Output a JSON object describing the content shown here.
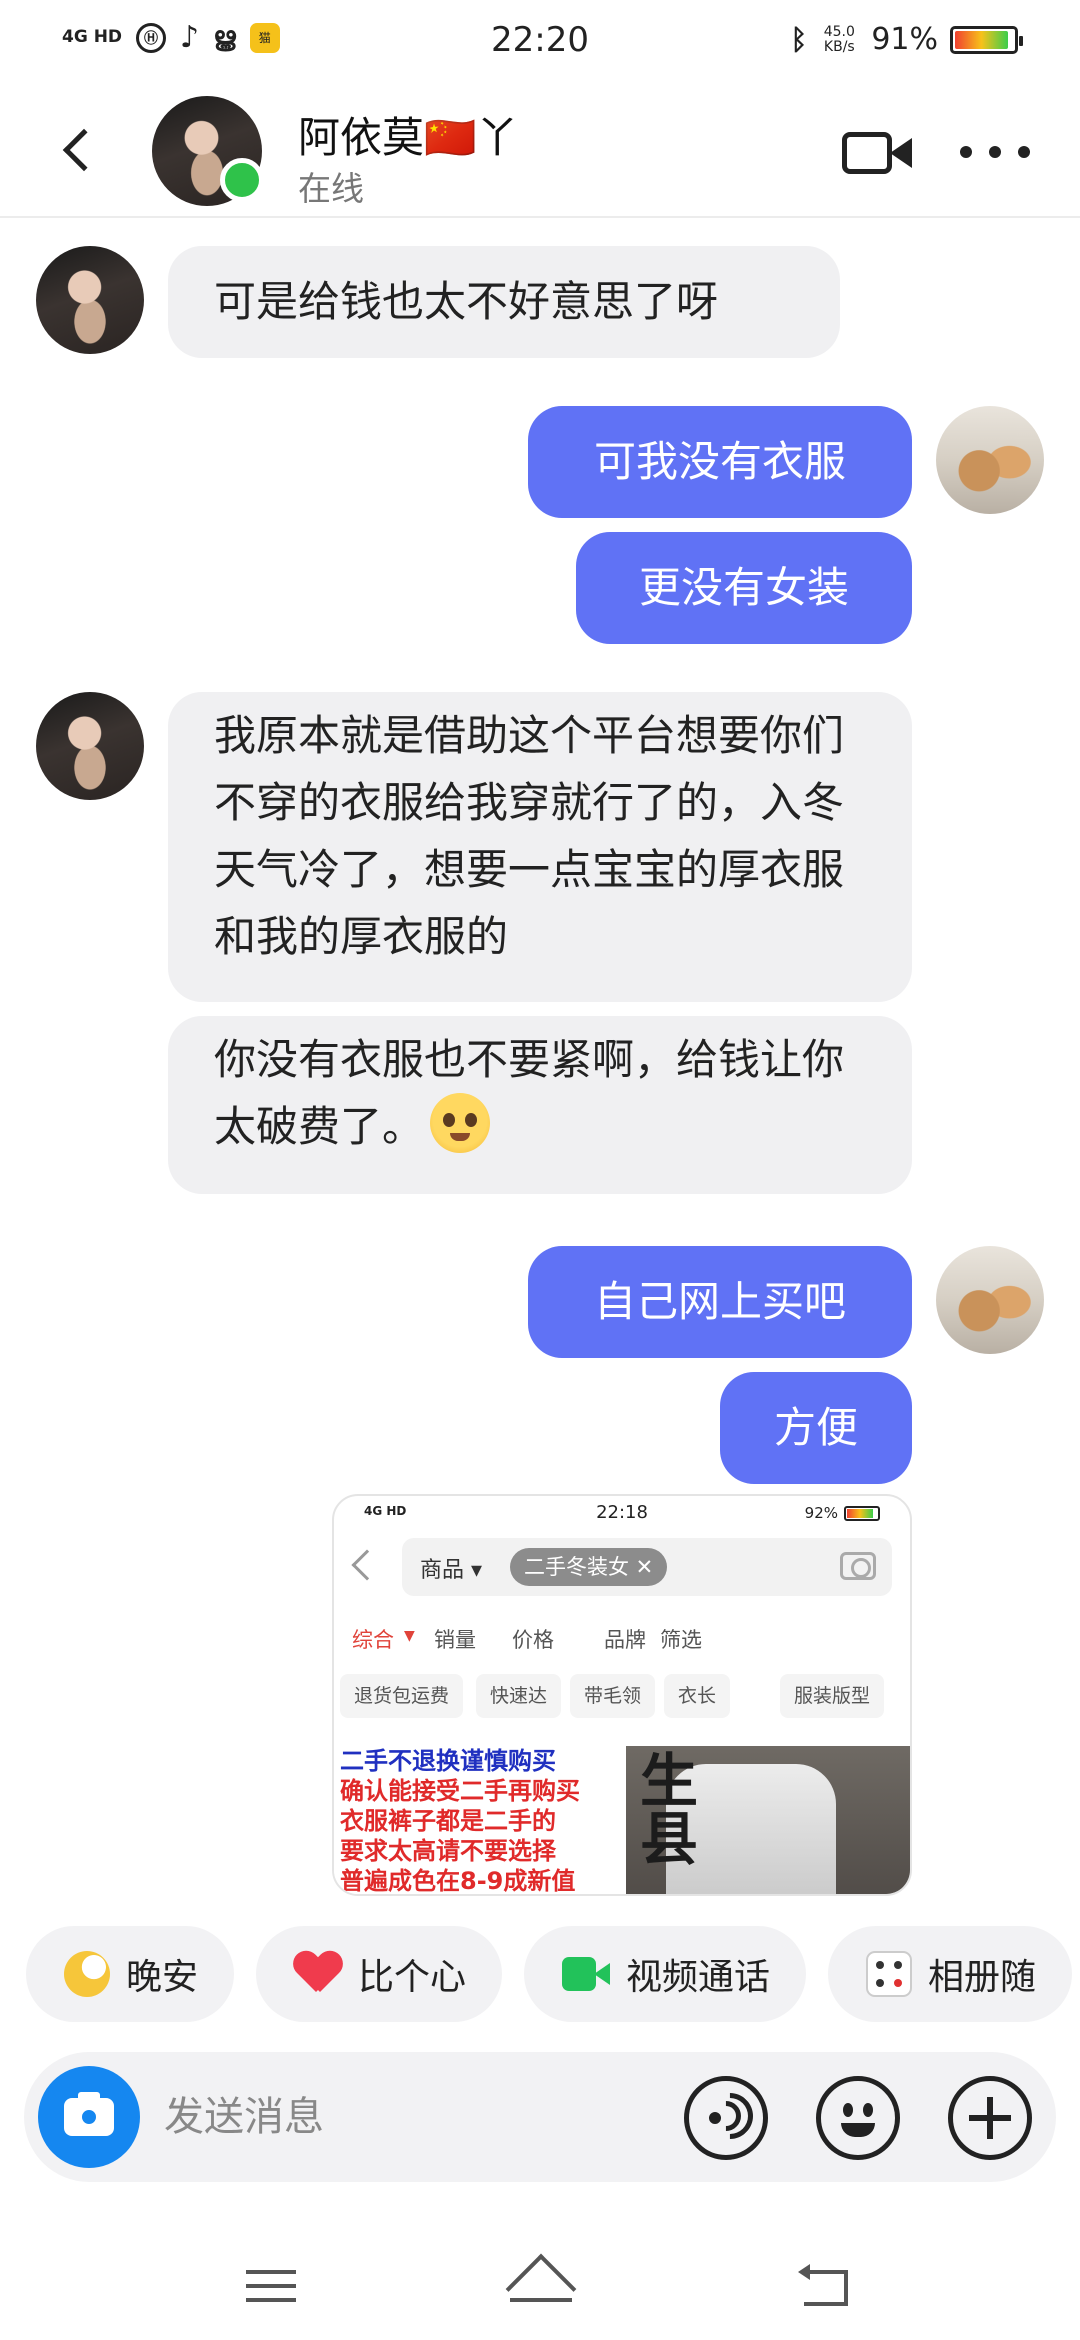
{
  "status_bar": {
    "signal": "4G HD",
    "time": "22:20",
    "net_speed": "45.0 KB/s",
    "battery": "91%",
    "battery_level": 0.91
  },
  "header": {
    "contact_name": "阿依莫🇨🇳丫",
    "presence": "在线"
  },
  "messages": [
    {
      "from": "them",
      "text": "可是给钱也太不好意思了呀"
    },
    {
      "from": "me",
      "text": "可我没有衣服"
    },
    {
      "from": "me",
      "text": "更没有女装"
    },
    {
      "from": "them",
      "text": "我原本就是借助这个平台想要你们不穿的衣服给我穿就行了的，入冬天气冷了，想要一点宝宝的厚衣服和我的厚衣服的"
    },
    {
      "from": "them",
      "text": "你没有衣服也不要紧啊，给钱让你太破费了。",
      "emoji": "pleading-face"
    },
    {
      "from": "me",
      "text": "自己网上买吧"
    },
    {
      "from": "me",
      "text": "方便"
    }
  ],
  "shared_screenshot": {
    "time": "22:18",
    "battery": "92%",
    "category": "商品",
    "search_chip": "二手冬装女",
    "sorts": [
      "综合",
      "销量",
      "价格",
      "品牌",
      "筛选"
    ],
    "filters": [
      "退货包运费",
      "快速达",
      "带毛领",
      "衣长",
      "服装版型"
    ],
    "banner_lines": [
      "二手不退换谨慎购买",
      "确认能接受二手再购买",
      "衣服裤子都是二手的",
      "要求太高请不要选择",
      "普遍成色在8-9成新值"
    ],
    "image_text": "生县"
  },
  "quick_actions": [
    {
      "label": "晚安",
      "icon": "moon-icon"
    },
    {
      "label": "比个心",
      "icon": "heart-icon"
    },
    {
      "label": "视频通话",
      "icon": "video-icon"
    },
    {
      "label": "相册随",
      "icon": "dice-icon"
    }
  ],
  "input": {
    "placeholder": "发送消息"
  },
  "colors": {
    "outgoing_bubble": "#6072f5",
    "incoming_bubble": "#f0f0f2",
    "online": "#2fc24a",
    "camera_button": "#1587f0"
  }
}
